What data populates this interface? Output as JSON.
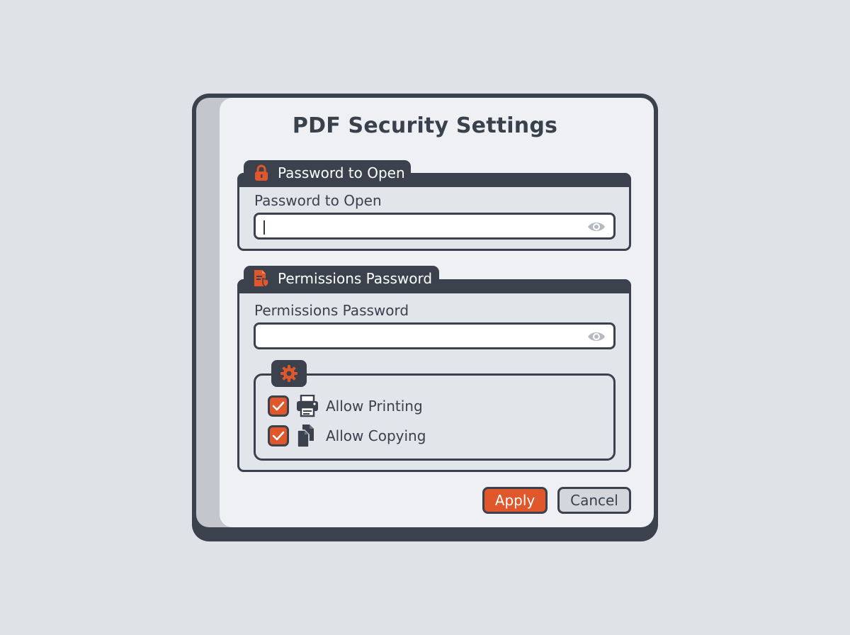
{
  "dialog": {
    "title": "PDF Security Settings"
  },
  "open_group": {
    "tab_label": "Password to Open",
    "tab_icon": "lock-icon",
    "field_label": "Password to Open",
    "value": "",
    "reveal_icon": "eye-icon"
  },
  "permissions_group": {
    "tab_label": "Permissions Password",
    "tab_icon": "document-shield-icon",
    "field_label": "Permissions Password",
    "value": "",
    "reveal_icon": "eye-icon",
    "options_icon": "gear-icon",
    "options": [
      {
        "label": "Allow Printing",
        "icon": "printer-icon",
        "checked": true
      },
      {
        "label": "Allow Copying",
        "icon": "copy-documents-icon",
        "checked": true
      }
    ]
  },
  "buttons": {
    "apply": "Apply",
    "cancel": "Cancel"
  },
  "colors": {
    "accent": "#e0572c",
    "frame": "#3b424d",
    "surface": "#eef0f3",
    "group_surface": "#e2e5e9"
  }
}
